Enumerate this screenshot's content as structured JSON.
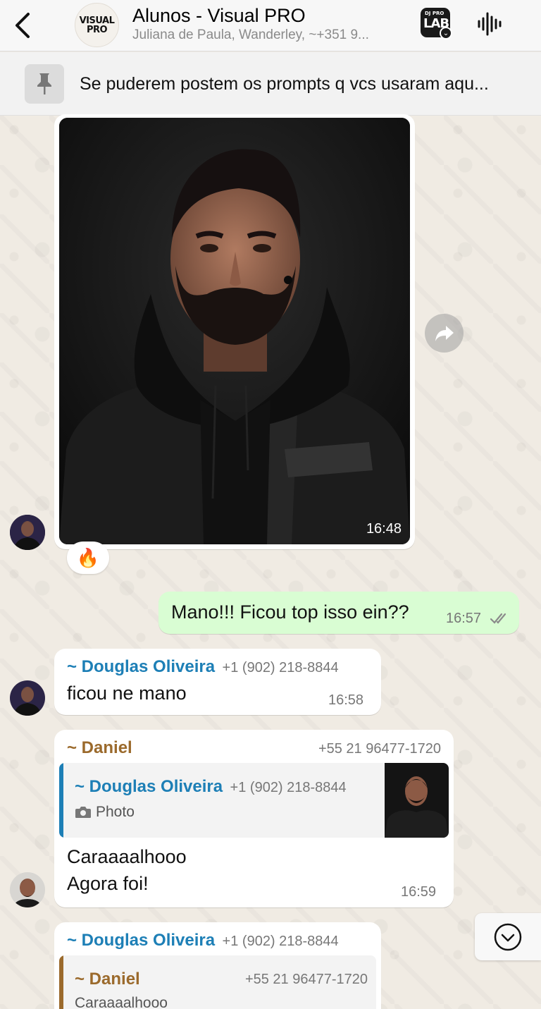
{
  "header": {
    "back_icon": "chevron-left-icon",
    "avatar_line1": "VISUAL",
    "avatar_line2": "PRO",
    "title": "Alunos - Visual PRO",
    "subtitle": "Juliana de Paula, Wanderley, ~+351 9...",
    "lab_icon_top": "DJ PRO",
    "lab_icon_text": "LAB",
    "audio_icon": "audio-waveform-icon"
  },
  "pinned": {
    "icon": "pin-icon",
    "text": "Se puderem postem os prompts q vcs usaram aqu..."
  },
  "messages": {
    "photo_msg": {
      "time": "16:48",
      "reaction": "🔥"
    },
    "out_msg": {
      "text": "Mano!!! Ficou top isso ein??",
      "time": "16:57",
      "status_icon": "double-check-icon"
    },
    "msg2": {
      "sender": "~ Douglas Oliveira",
      "phone": "+1 (902) 218-8844",
      "text": "ficou ne mano",
      "time": "16:58"
    },
    "msg3": {
      "sender": "~ Daniel",
      "phone": "+55 21 96477-1720",
      "quote_sender": "~ Douglas Oliveira",
      "quote_phone": "+1 (902) 218-8844",
      "quote_type": "Photo",
      "line1": "Caraaaalhooo",
      "line2": "Agora foi!",
      "time": "16:59"
    },
    "msg4": {
      "sender": "~ Douglas Oliveira",
      "phone": "+1 (902) 218-8844",
      "quote_sender": "~ Daniel",
      "quote_phone": "+55 21 96477-1720",
      "quote_text": "Caraaaalhooo"
    }
  },
  "colors": {
    "douglas": "#1d7fb6",
    "daniel": "#9b6a2c",
    "out_bubble": "#d9fdd3"
  }
}
